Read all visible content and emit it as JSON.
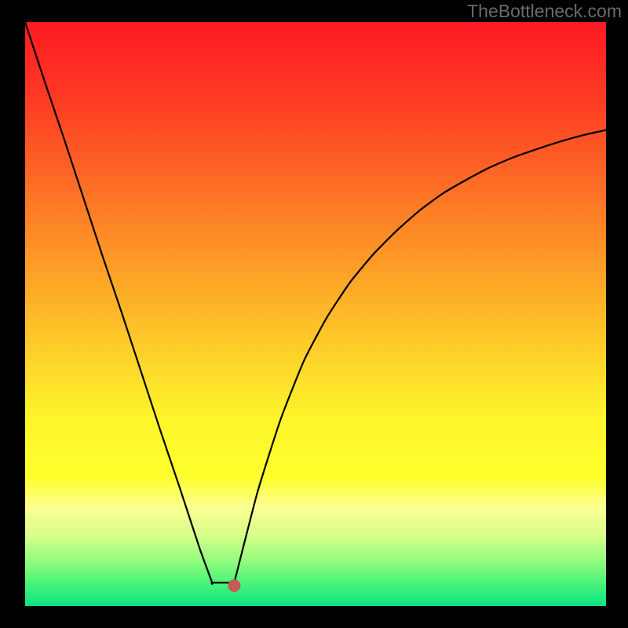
{
  "watermark": "TheBottleneck.com",
  "chart_data": {
    "type": "line",
    "title": "",
    "xlabel": "",
    "ylabel": "",
    "xlim": [
      0,
      1
    ],
    "ylim": [
      0,
      1
    ],
    "background_gradient": {
      "stops": [
        {
          "offset": 0.0,
          "color": "#fe1a22"
        },
        {
          "offset": 0.12,
          "color": "#fd3723"
        },
        {
          "offset": 0.25,
          "color": "#fd6325"
        },
        {
          "offset": 0.4,
          "color": "#fd9727"
        },
        {
          "offset": 0.55,
          "color": "#fdcb29"
        },
        {
          "offset": 0.68,
          "color": "#fef52b"
        },
        {
          "offset": 0.78,
          "color": "#feff2c"
        },
        {
          "offset": 0.83,
          "color": "#fdff92"
        },
        {
          "offset": 0.88,
          "color": "#d6fe8b"
        },
        {
          "offset": 0.92,
          "color": "#97fc7f"
        },
        {
          "offset": 0.96,
          "color": "#4cf47a"
        },
        {
          "offset": 1.0,
          "color": "#0be383"
        }
      ]
    },
    "curves": [
      {
        "name": "left-branch",
        "x": [
          0.0,
          0.033,
          0.067,
          0.1,
          0.133,
          0.167,
          0.2,
          0.233,
          0.267,
          0.3,
          0.322
        ],
        "y": [
          1.0,
          0.9,
          0.8,
          0.7,
          0.6,
          0.5,
          0.4,
          0.3,
          0.2,
          0.1,
          0.04
        ]
      },
      {
        "name": "flat-floor",
        "x": [
          0.322,
          0.36
        ],
        "y": [
          0.04,
          0.04
        ]
      },
      {
        "name": "right-branch",
        "x": [
          0.36,
          0.4,
          0.44,
          0.48,
          0.52,
          0.56,
          0.6,
          0.64,
          0.68,
          0.72,
          0.76,
          0.8,
          0.84,
          0.88,
          0.92,
          0.96,
          1.0
        ],
        "y": [
          0.04,
          0.195,
          0.32,
          0.42,
          0.495,
          0.555,
          0.603,
          0.643,
          0.678,
          0.707,
          0.73,
          0.751,
          0.768,
          0.782,
          0.795,
          0.806,
          0.815
        ]
      }
    ],
    "marker": {
      "x": 0.36,
      "y": 0.035,
      "color": "#c75a55",
      "radius": 8
    }
  }
}
